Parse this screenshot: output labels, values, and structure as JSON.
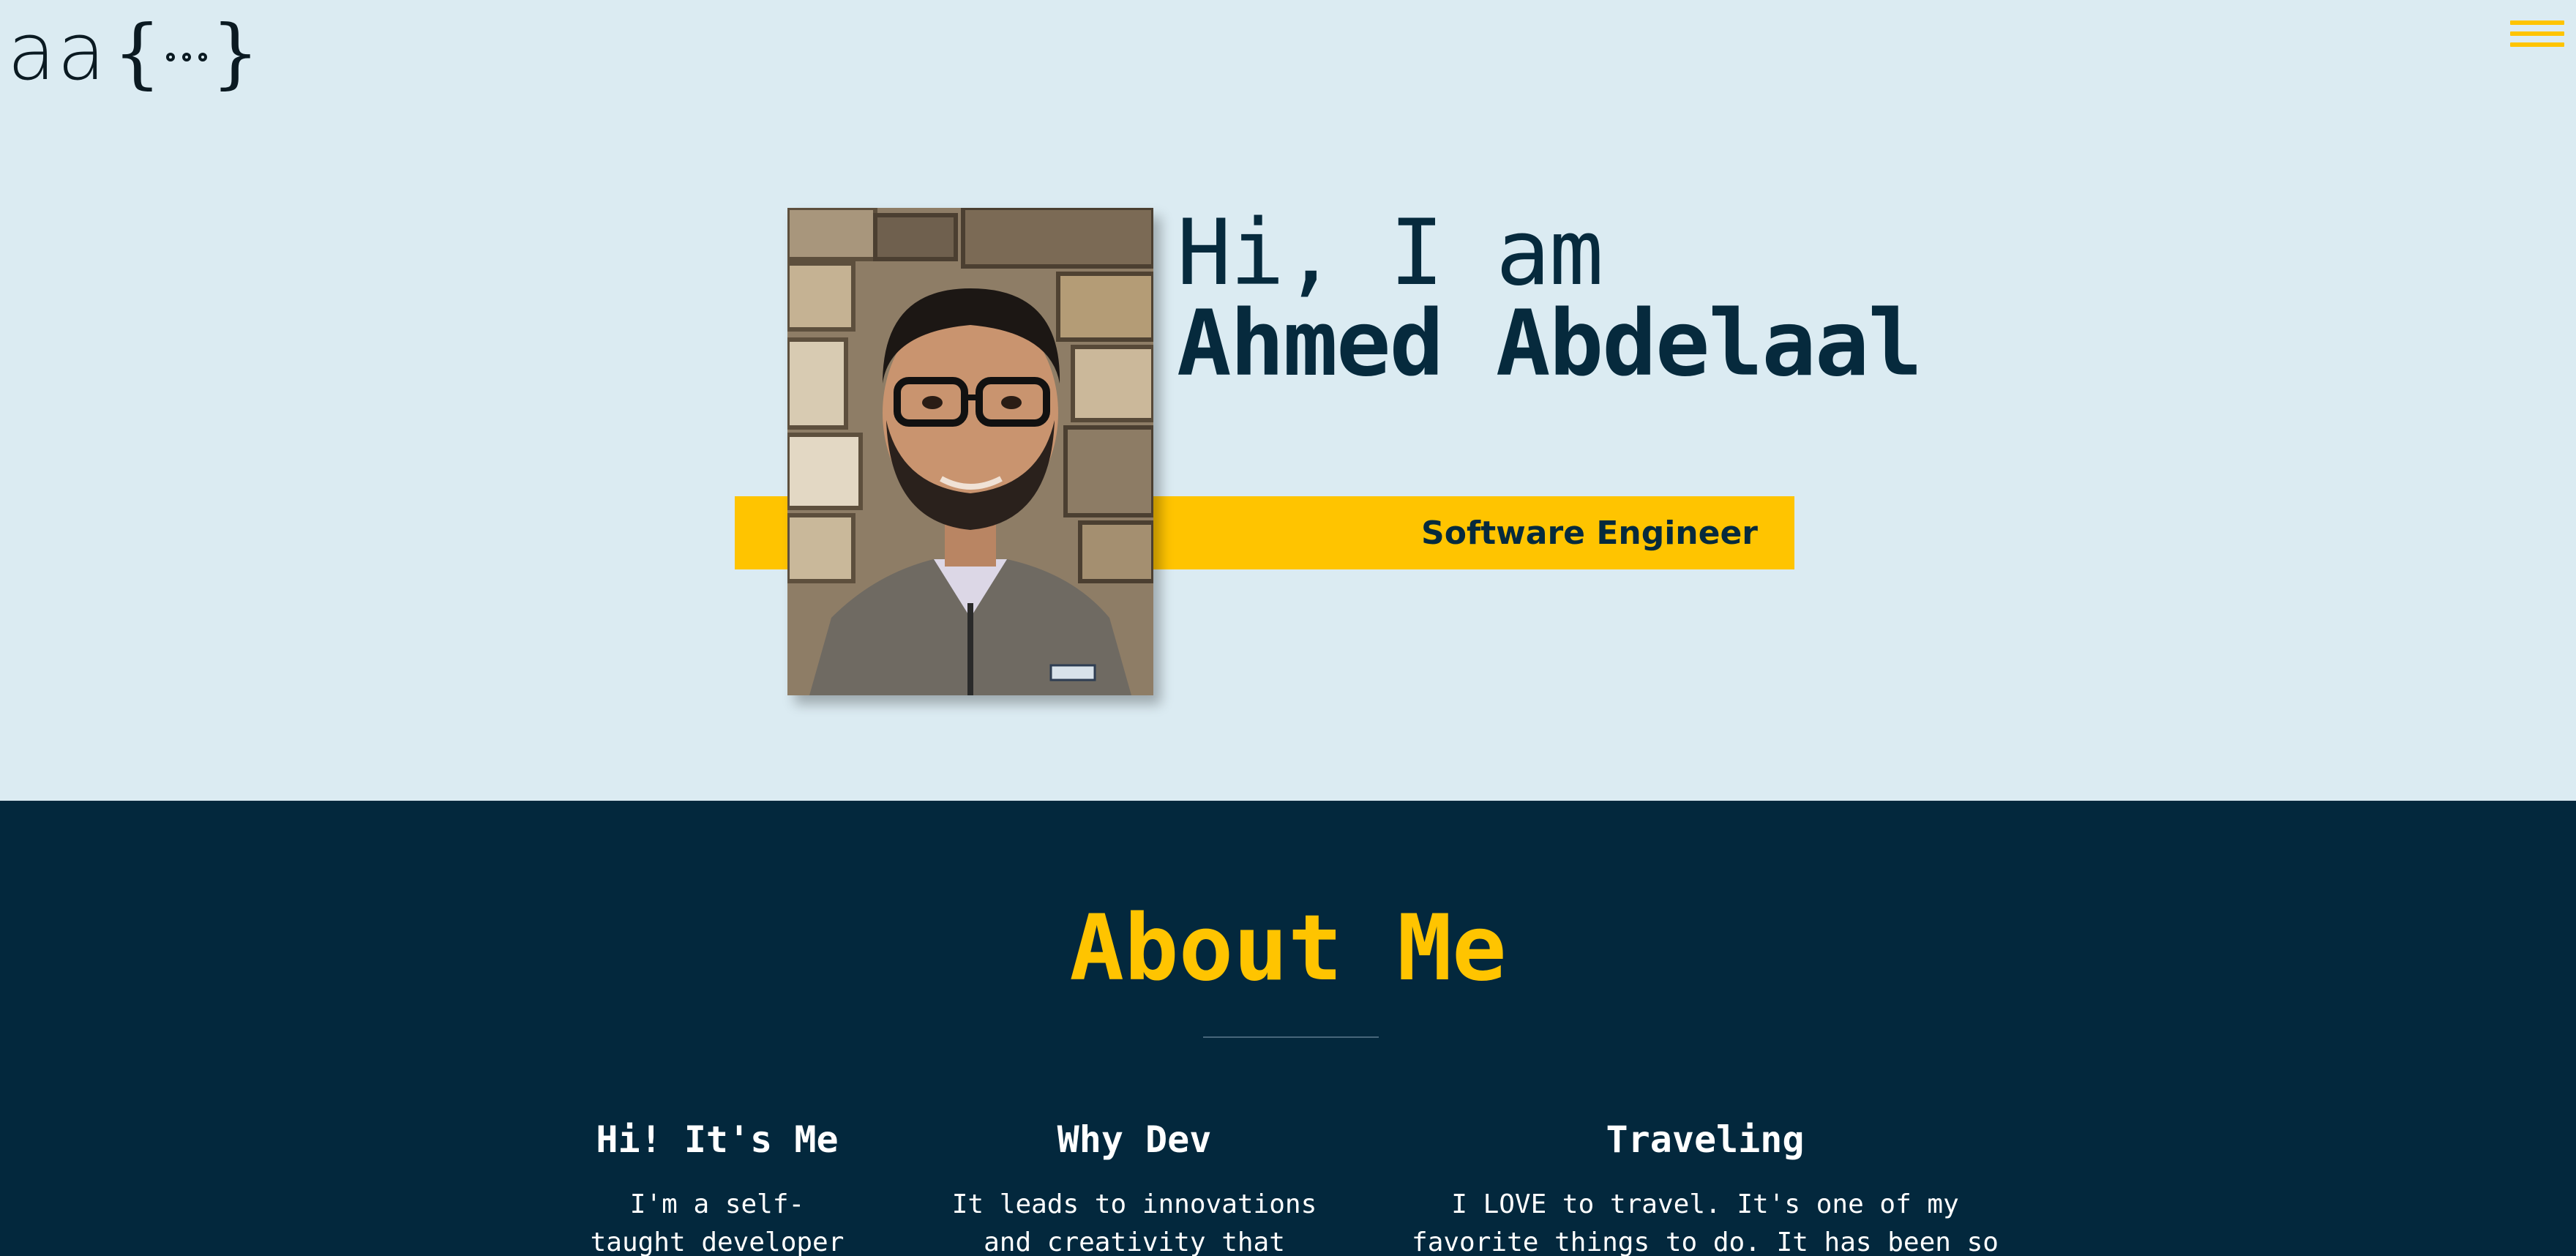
{
  "header": {
    "logo_letters": "aa",
    "logo_brace_open": "{",
    "logo_brace_close": "}",
    "menu_icon": "hamburger-icon"
  },
  "hero": {
    "greeting": "Hi, I am",
    "name": "Ahmed Abdelaal",
    "role": "Software Engineer",
    "portrait_alt": "Portrait photo"
  },
  "about": {
    "title": "About Me",
    "columns": [
      {
        "heading": "Hi! It's Me",
        "text": "I'm a self-taught developer who is"
      },
      {
        "heading": "Why Dev",
        "text": "It leads to innovations and creativity that literally"
      },
      {
        "heading": "Traveling",
        "text": "I LOVE to travel. It's one of my favorite things to do. It has been so important to my"
      }
    ]
  },
  "colors": {
    "background": "#dbebf2",
    "accent": "#ffc400",
    "navy": "#03283d",
    "text_dark": "#062a3d"
  }
}
